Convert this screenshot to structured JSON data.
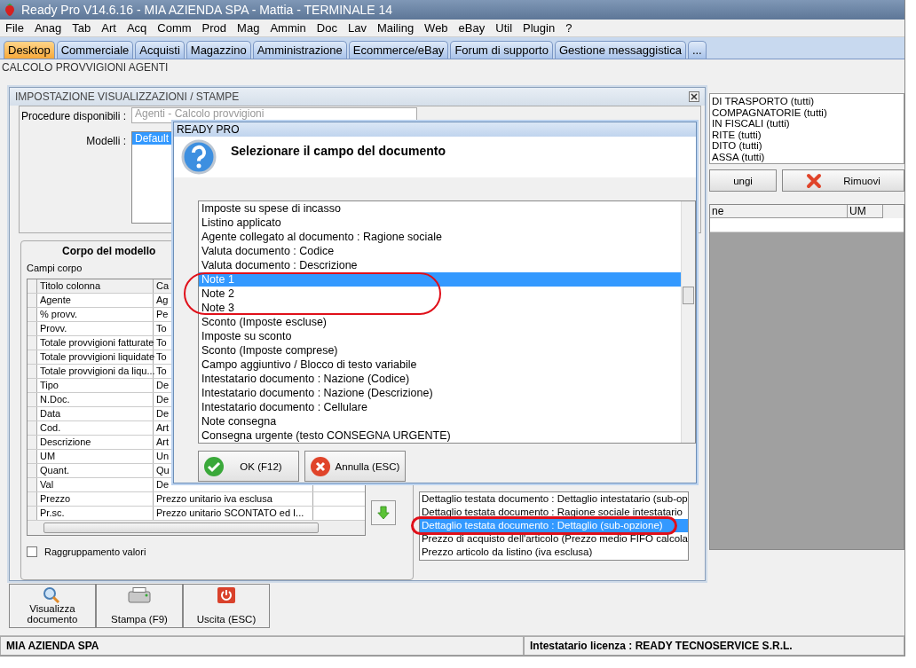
{
  "window": {
    "title": "Ready Pro V14.6.16 - MIA AZIENDA SPA - Mattia - TERMINALE 14"
  },
  "menu": [
    "File",
    "Anag",
    "Tab",
    "Art",
    "Acq",
    "Comm",
    "Prod",
    "Mag",
    "Ammin",
    "Doc",
    "Lav",
    "Mailing",
    "Web",
    "eBay",
    "Util",
    "Plugin",
    "?"
  ],
  "tabs": [
    {
      "label": "Desktop",
      "selected": true
    },
    {
      "label": "Commerciale",
      "selected": false
    },
    {
      "label": "Acquisti",
      "selected": false
    },
    {
      "label": "Magazzino",
      "selected": false
    },
    {
      "label": "Amministrazione",
      "selected": false
    },
    {
      "label": "Ecommerce/eBay",
      "selected": false
    },
    {
      "label": "Forum di supporto",
      "selected": false
    },
    {
      "label": "Gestione messaggistica",
      "selected": false
    },
    {
      "label": "...",
      "selected": false
    }
  ],
  "section_title": "CALCOLO PROVVIGIONI AGENTI",
  "background_panel": {
    "list": [
      "DI TRASPORTO (tutti)",
      "COMPAGNATORIE (tutti)",
      "IN FISCALI (tutti)",
      "RITE (tutti)",
      "DITO (tutti)",
      "ASSA (tutti)"
    ],
    "buttons": [
      {
        "label": "ungi",
        "kind": "plain"
      },
      {
        "label": "Rimuovi",
        "kind": "remove"
      }
    ],
    "grid_columns": [
      "ne",
      "UM"
    ]
  },
  "settings_window": {
    "title": "IMPOSTAZIONE VISUALIZZAZIONI / STAMPE",
    "procedure_label": "Procedure disponibili :",
    "procedure_value": "Agenti - Calcolo provvigioni",
    "models_label": "Modelli :",
    "models": [
      {
        "label": "Default",
        "selected": true
      }
    ],
    "body_title": "Corpo del modello",
    "fields_label": "Campi corpo",
    "grid_columns": [
      "Titolo colonna",
      "Ca"
    ],
    "grid_rows": [
      [
        "Agente",
        "Ag"
      ],
      [
        "% provv.",
        "Pe"
      ],
      [
        "Provv.",
        "To"
      ],
      [
        "Totale provvigioni fatturate",
        "To"
      ],
      [
        "Totale provvigioni liquidate",
        "To"
      ],
      [
        "Totale provvigioni da liqu...",
        "To"
      ],
      [
        "Tipo",
        "De"
      ],
      [
        "N.Doc.",
        "De"
      ],
      [
        "Data",
        "De"
      ],
      [
        "Cod.",
        "Art"
      ],
      [
        "Descrizione",
        "Art"
      ],
      [
        "UM",
        "Un"
      ],
      [
        "Quant.",
        "Qu"
      ],
      [
        "Val",
        "De"
      ],
      [
        "Prezzo",
        "Prezzo unitario iva esclusa"
      ],
      [
        "Pr.sc.",
        "Prezzo unitario SCONTATO ed I..."
      ]
    ],
    "grouping": {
      "label": "Raggruppamento valori",
      "checked": false
    },
    "field_list": [
      {
        "label": "Dettaglio testata documento : Dettaglio intestatario (sub-op",
        "selected": false
      },
      {
        "label": "Dettaglio testata documento : Ragione sociale intestatario",
        "selected": false
      },
      {
        "label": "Dettaglio testata documento : Dettaglio (sub-opzione)",
        "selected": true
      },
      {
        "label": "Prezzo di acquisto dell'articolo (Prezzo medio FIFO calcola",
        "selected": false
      },
      {
        "label": "Prezzo articolo da listino (iva esclusa)",
        "selected": false
      }
    ]
  },
  "dialog": {
    "title": "READY PRO",
    "heading": "Selezionare il campo del documento",
    "items": [
      {
        "label": "Imposte su spese di incasso",
        "selected": false
      },
      {
        "label": "Listino applicato",
        "selected": false
      },
      {
        "label": "Agente collegato al documento : Ragione sociale",
        "selected": false
      },
      {
        "label": "Valuta documento : Codice",
        "selected": false
      },
      {
        "label": "Valuta documento : Descrizione",
        "selected": false
      },
      {
        "label": "Note 1",
        "selected": true
      },
      {
        "label": "Note 2",
        "selected": false
      },
      {
        "label": "Note 3",
        "selected": false
      },
      {
        "label": "Sconto (Imposte escluse)",
        "selected": false
      },
      {
        "label": "Imposte su sconto",
        "selected": false
      },
      {
        "label": "Sconto (Imposte comprese)",
        "selected": false
      },
      {
        "label": "Campo aggiuntivo / Blocco di testo variabile",
        "selected": false
      },
      {
        "label": "Intestatario documento : Nazione (Codice)",
        "selected": false
      },
      {
        "label": "Intestatario documento : Nazione (Descrizione)",
        "selected": false
      },
      {
        "label": "Intestatario documento : Cellulare",
        "selected": false
      },
      {
        "label": "Note consegna",
        "selected": false
      },
      {
        "label": "Consegna urgente (testo CONSEGNA URGENTE)",
        "selected": false
      }
    ],
    "buttons": [
      {
        "label": "OK (F12)",
        "kind": "ok"
      },
      {
        "label": "Annulla (ESC)",
        "kind": "cancel"
      }
    ]
  },
  "actions": [
    {
      "label": "Visualizza documento",
      "kind": "view"
    },
    {
      "label": "Stampa (F9)",
      "kind": "print"
    },
    {
      "label": "Uscita (ESC)",
      "kind": "exit"
    }
  ],
  "status_bar": [
    "MIA AZIENDA SPA",
    "Intestatario licenza : READY TECNOSERVICE S.R.L."
  ]
}
